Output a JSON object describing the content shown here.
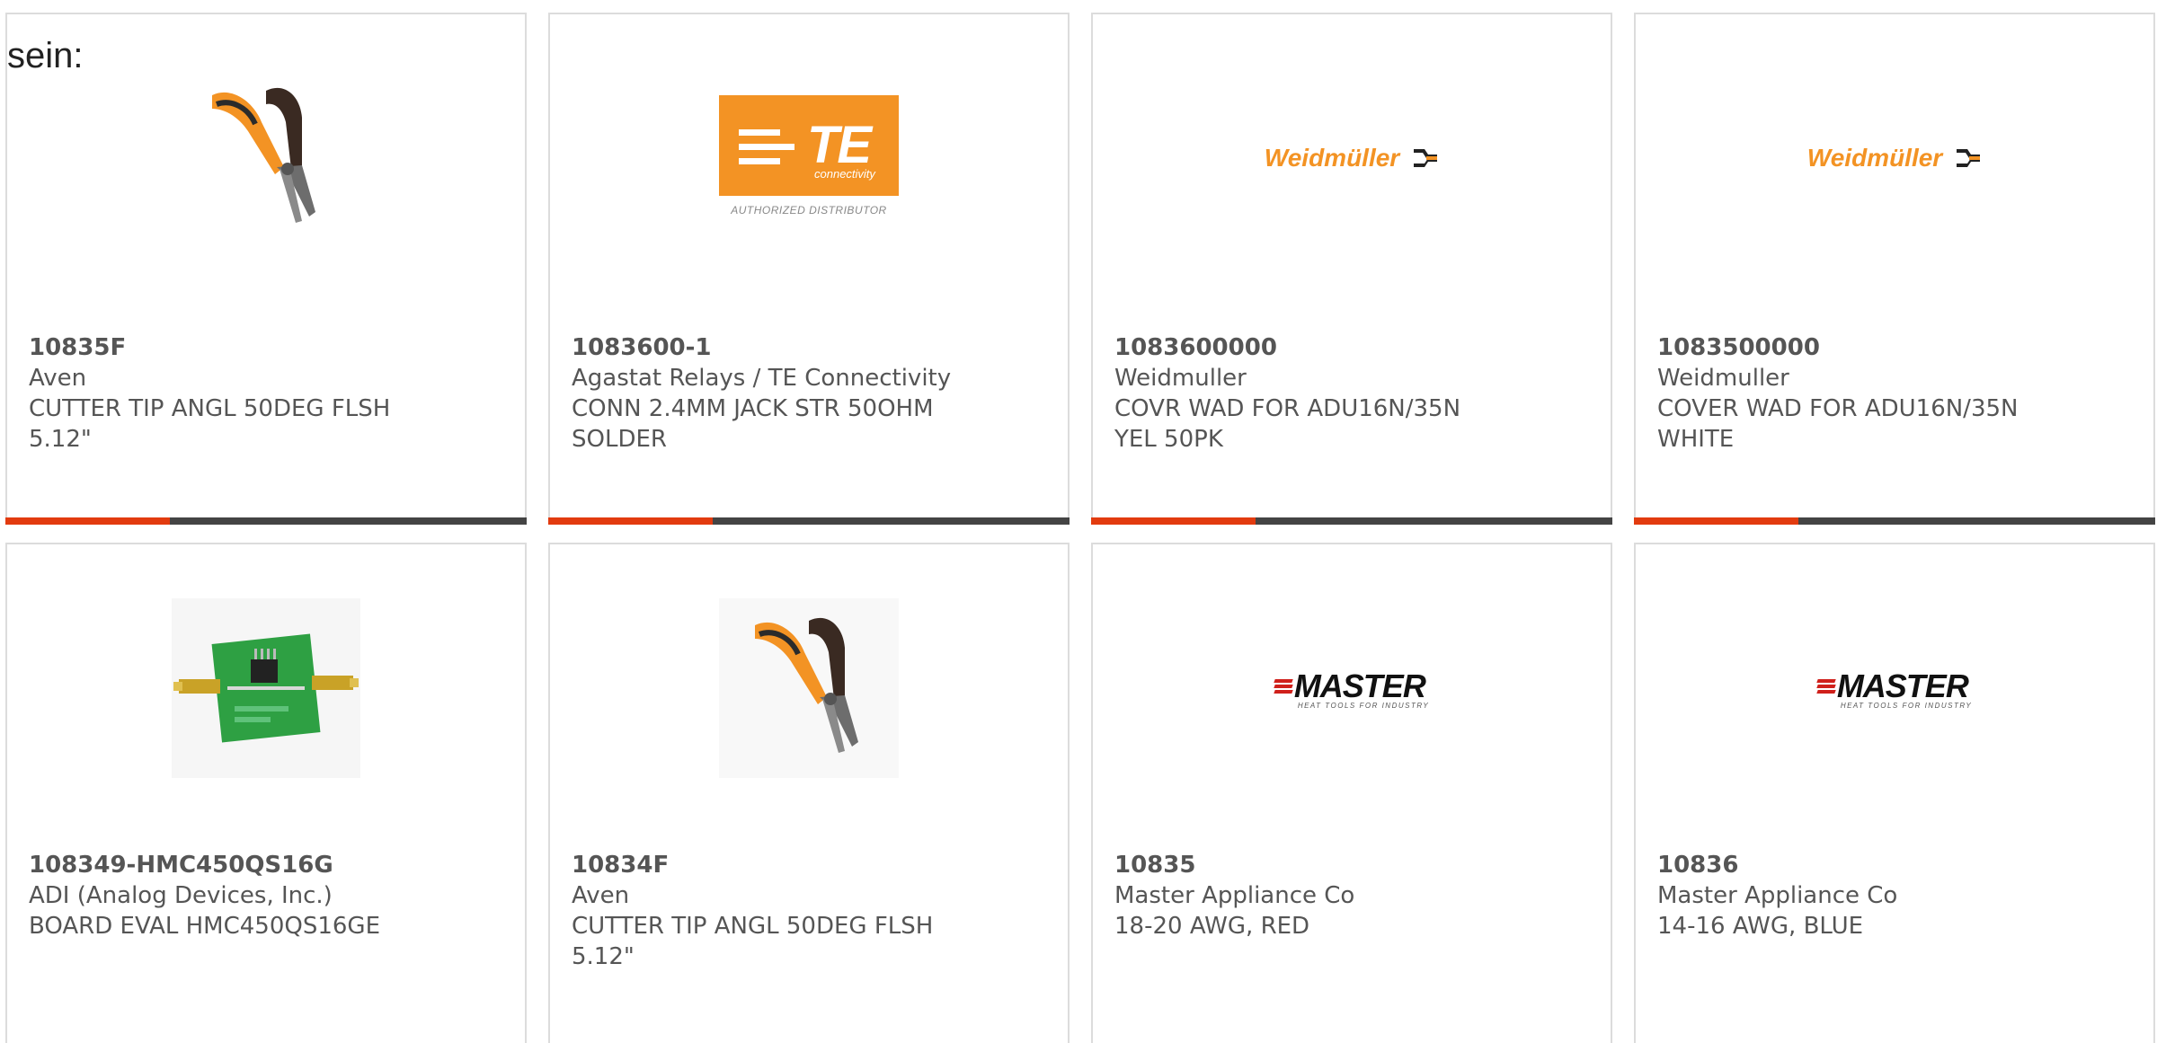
{
  "intro_text": "sein:",
  "colors": {
    "accent_bar": "#e23b0f",
    "dark_bar": "#444444",
    "te_orange": "#f39324",
    "weidmuller_orange": "#f39324",
    "master_red": "#d0201b"
  },
  "products": [
    {
      "image": "flush-cutter-pliers",
      "part_number": "10835F",
      "manufacturer": "Aven",
      "description": "CUTTER TIP ANGL 50DEG FLSH 5.12\""
    },
    {
      "image": "te-connectivity-logo",
      "part_number": "1083600-1",
      "manufacturer": "Agastat Relays / TE Connectivity",
      "description": "CONN 2.4MM JACK STR 50OHM SOLDER"
    },
    {
      "image": "weidmuller-logo",
      "part_number": "1083600000",
      "manufacturer": "Weidmuller",
      "description": "COVR WAD FOR ADU16N/35N YEL 50PK"
    },
    {
      "image": "weidmuller-logo",
      "part_number": "1083500000",
      "manufacturer": "Weidmuller",
      "description": "COVER WAD FOR ADU16N/35N WHITE"
    },
    {
      "image": "eval-board",
      "part_number": "108349-HMC450QS16G",
      "manufacturer": "ADI (Analog Devices, Inc.)",
      "description": "BOARD EVAL HMC450QS16GE"
    },
    {
      "image": "flush-cutter-pliers",
      "part_number": "10834F",
      "manufacturer": "Aven",
      "description": "CUTTER TIP ANGL 50DEG FLSH 5.12\""
    },
    {
      "image": "master-logo",
      "part_number": "10835",
      "manufacturer": "Master Appliance Co",
      "description": "18-20 AWG, RED"
    },
    {
      "image": "master-logo",
      "part_number": "10836",
      "manufacturer": "Master Appliance Co",
      "description": "14-16 AWG, BLUE"
    }
  ],
  "logos": {
    "te_main": "TE",
    "te_sub": "connectivity",
    "te_authorized": "AUTHORIZED DISTRIBUTOR",
    "weidmuller": "Weidmüller",
    "master": "MASTER",
    "master_tagline": "HEAT TOOLS FOR INDUSTRY"
  }
}
